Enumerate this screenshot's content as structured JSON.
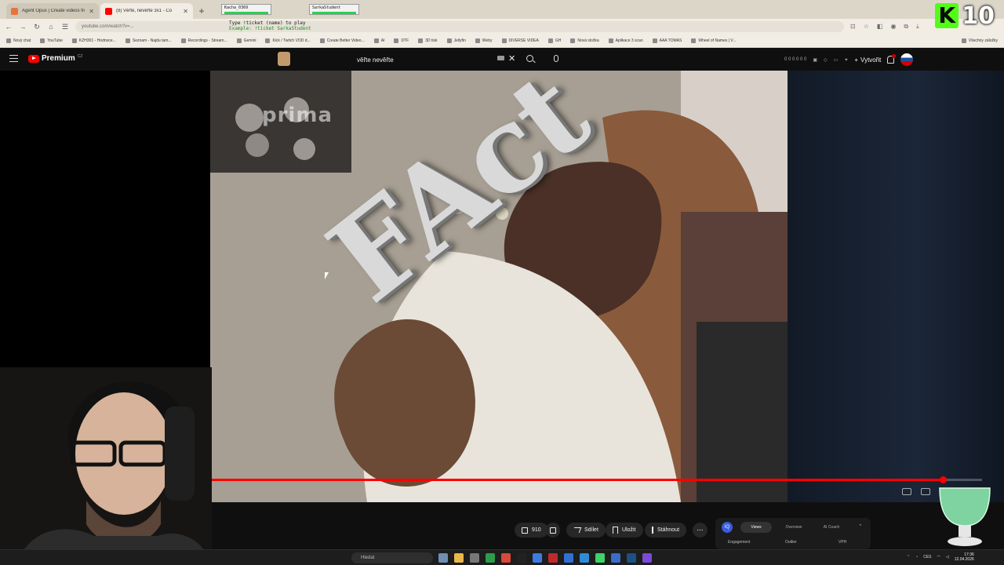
{
  "browser": {
    "tabs": [
      {
        "title": "Agent Opus | Create videos fro",
        "active": false,
        "color": "#e7743d"
      },
      {
        "title": "(8) Věřte, nevěřte 3x1 - Co",
        "active": true,
        "color": "#ff0000"
      }
    ],
    "stream_badges": [
      "Kacha_0369",
      "SarkaStudent"
    ],
    "url": "youtube.com/watch?v=...",
    "stream_overlay": {
      "line1": "Type !ticket (name) to play",
      "line2": "Example: !ticket SarkaStudent"
    },
    "bookmarks": [
      "Nový chat",
      "YouTube",
      "KZH301 - Hodnoce...",
      "Seznam - Najdu tam...",
      "Recordings - Stream...",
      "Gemini",
      "Kick / Twitch VOD d...",
      "Create Better Video...",
      "AI",
      "DTF",
      "3D tisk",
      "Jellyfin",
      "Weby",
      "DIVERSE VIDEA",
      "GH",
      "Nová složka",
      "Aplikace 3 scan",
      "AAA TOMAS",
      "Wheel of Names | V..."
    ],
    "bookmarks_right": "Všechny záložky"
  },
  "kick_badge": {
    "letter": "K",
    "count": "10"
  },
  "youtube": {
    "logo": "Premium",
    "region": "CZ",
    "search_value": "věřte nevěřte",
    "create_label": "Vytvořit",
    "header_stats": "0 0  0 0  0 0"
  },
  "video": {
    "channel_watermark": "prima",
    "overlay_text": "FAct",
    "progress": 0.96
  },
  "actions": {
    "like_count": "910",
    "share": "Sdílet",
    "save": "Uložit",
    "download": "Stáhnout",
    "more": "..."
  },
  "extension": {
    "logo": "IQ",
    "tabs": [
      "Views",
      "Overview",
      "AI Coach"
    ],
    "sublabels": [
      "Engagement",
      "Outlier",
      "VPH"
    ]
  },
  "taskbar": {
    "search_placeholder": "Hledat",
    "lang": "CES",
    "time": "17:36",
    "date": "12.04.2026"
  },
  "colors": {
    "accent": "#ff0000",
    "kick_green": "#53fc18",
    "background": "#0f0f0f"
  }
}
